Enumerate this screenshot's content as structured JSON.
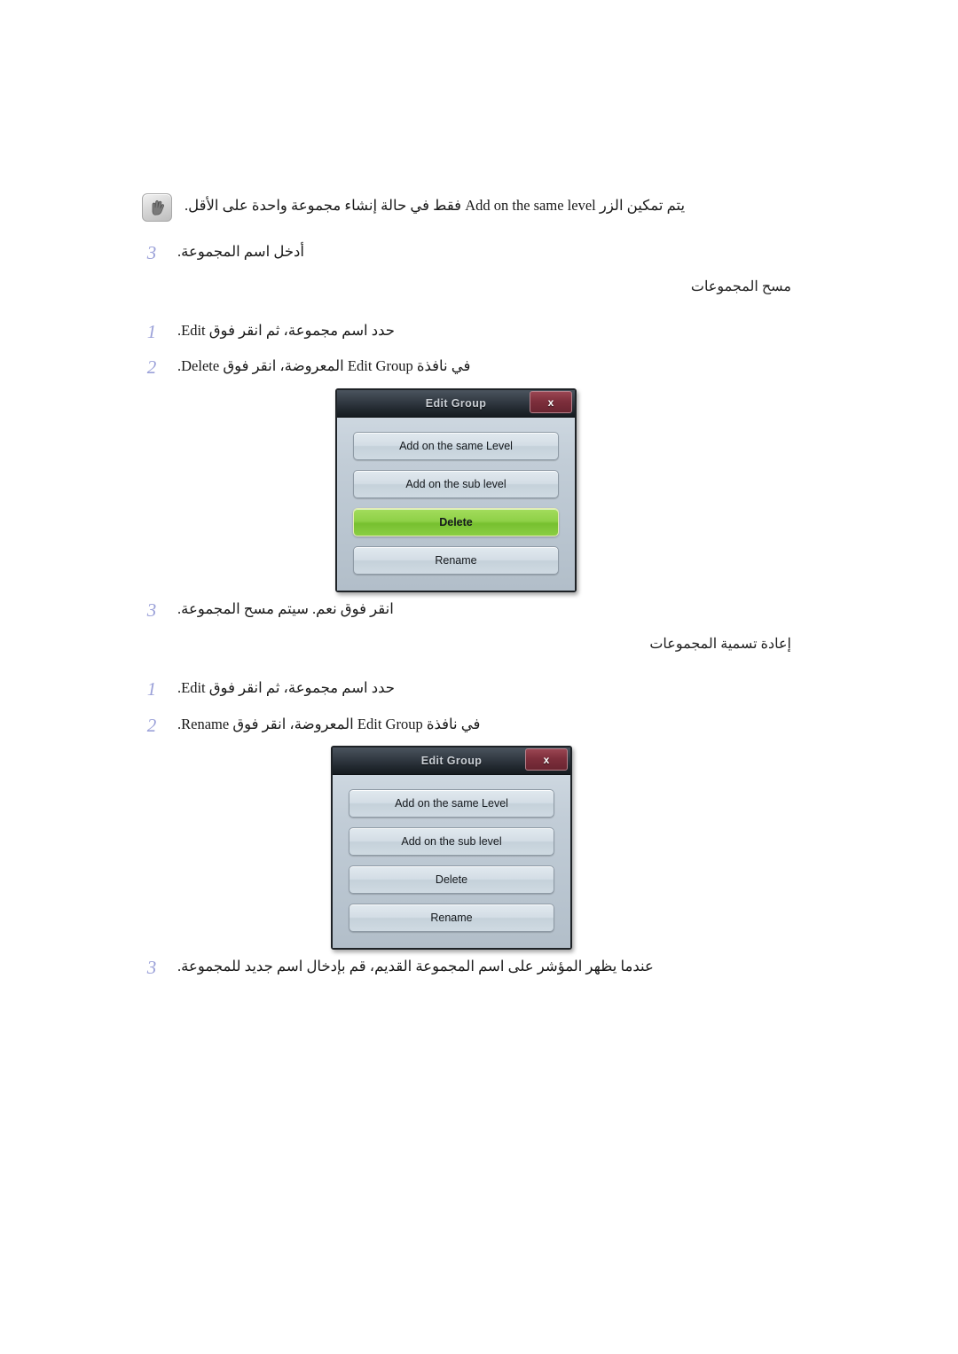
{
  "note": {
    "icon": "note-pencil-icon",
    "text": "يتم تمكين الزر Add on the same level فقط في حالة إنشاء مجموعة واحدة على الأقل."
  },
  "steps_intro": [
    {
      "num": "3",
      "text": "أدخل اسم المجموعة."
    }
  ],
  "sections": [
    {
      "heading": "مسح المجموعات",
      "steps": [
        {
          "num": "1",
          "text": "حدد اسم مجموعة، ثم انقر فوق Edit."
        },
        {
          "num": "2",
          "text": "في نافذة Edit Group المعروضة، انقر فوق Delete."
        },
        {
          "num": "3",
          "text": "انقر فوق نعم. سيتم مسح المجموعة."
        }
      ]
    },
    {
      "heading": "إعادة تسمية المجموعات",
      "steps": [
        {
          "num": "1",
          "text": "حدد اسم مجموعة، ثم انقر فوق Edit."
        },
        {
          "num": "2",
          "text": "في نافذة Edit Group المعروضة، انقر فوق Rename."
        },
        {
          "num": "3",
          "text": "عندما يظهر المؤشر على اسم المجموعة القديم، قم بإدخال اسم جديد للمجموعة."
        }
      ]
    }
  ],
  "dialogs": [
    {
      "title": "Edit Group",
      "close_label": "x",
      "buttons": [
        {
          "label": "Add on the same Level",
          "state": "normal"
        },
        {
          "label": "Add on the sub level",
          "state": "normal"
        },
        {
          "label": "Delete",
          "state": "selected"
        },
        {
          "label": "Rename",
          "state": "normal"
        }
      ]
    },
    {
      "title": "Edit Group",
      "close_label": "x",
      "buttons": [
        {
          "label": "Add on the same Level",
          "state": "normal"
        },
        {
          "label": "Add on the sub level",
          "state": "normal"
        },
        {
          "label": "Delete",
          "state": "normal"
        },
        {
          "label": "Rename",
          "state": "normal"
        }
      ]
    }
  ],
  "colors": {
    "step_number": "#9aa0d8",
    "dialog_titlebar": "#222930",
    "dialog_body": "#c2cdd7",
    "selected_button": "#8fd148",
    "close_button": "#7e2f3c"
  }
}
